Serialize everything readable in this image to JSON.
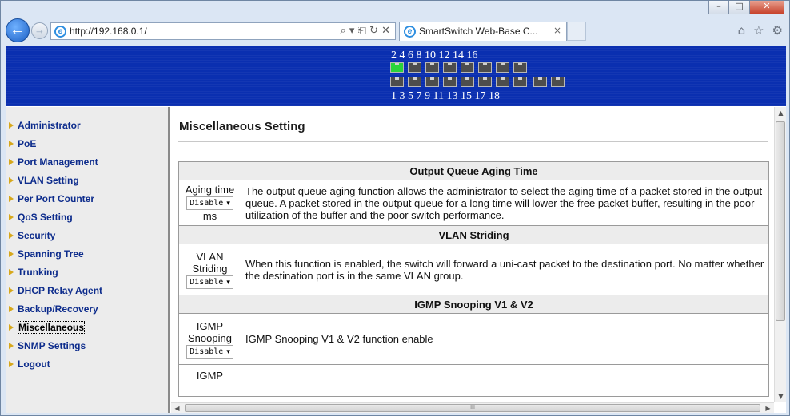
{
  "browser": {
    "url": "http://192.168.0.1/",
    "address_icons": "⌕ ▾ ⎗ ↻ ✕",
    "tab_title": "SmartSwitch Web-Base C...",
    "tab_close": "×",
    "window_buttons": {
      "minimize": "–",
      "maximize": "□",
      "close": "✕"
    },
    "toolbar_icons": {
      "home": "⌂",
      "favorites": "☆",
      "settings": "⚙"
    }
  },
  "banner": {
    "even_ports_label": "2 4 6 8 10 12 14 16",
    "odd_ports_label": "1 3 5 7 9 11 13 15 17 18",
    "port_link_up": [
      "2"
    ]
  },
  "sidebar": {
    "items": [
      {
        "label": "Administrator"
      },
      {
        "label": "PoE"
      },
      {
        "label": "Port Management"
      },
      {
        "label": "VLAN Setting"
      },
      {
        "label": "Per Port Counter"
      },
      {
        "label": "QoS Setting"
      },
      {
        "label": "Security"
      },
      {
        "label": "Spanning Tree"
      },
      {
        "label": "Trunking"
      },
      {
        "label": "DHCP Relay Agent"
      },
      {
        "label": "Backup/Recovery"
      },
      {
        "label": "Miscellaneous"
      },
      {
        "label": "SNMP Settings"
      },
      {
        "label": "Logout"
      }
    ],
    "selected": "Miscellaneous"
  },
  "content": {
    "title": "Miscellaneous Setting",
    "sections": [
      {
        "header": "Output Queue Aging Time",
        "label_line1": "Aging time",
        "select_value": "Disable",
        "label_unit": "ms",
        "description": "The output queue aging function allows the administrator to select the aging time of a packet stored in the output queue. A packet stored in the output queue for a long time will lower the free packet buffer, resulting in the poor utilization of the buffer and the poor switch performance."
      },
      {
        "header": "VLAN Striding",
        "label_line1": "VLAN",
        "label_line2": "Striding",
        "select_value": "Disable",
        "description": "When this function is enabled, the switch will forward a uni-cast packet to the destination port. No matter whether the destination port is in the same VLAN group."
      },
      {
        "header": "IGMP Snooping V1 & V2",
        "label_line1": "IGMP",
        "label_line2": "Snooping",
        "select_value": "Disable",
        "description": "IGMP Snooping V1 & V2 function enable"
      }
    ],
    "partial_row_label": "IGMP"
  },
  "scroll": {
    "up_arrow": "▲",
    "down_arrow": "▼",
    "left_arrow": "◀",
    "right_arrow": "▶",
    "h_thumb_grip": "III"
  }
}
